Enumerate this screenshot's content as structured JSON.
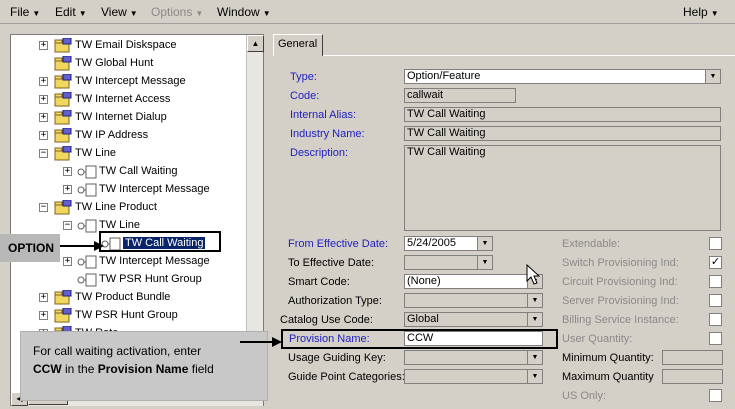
{
  "menubar": {
    "file": "File",
    "edit": "Edit",
    "view": "View",
    "options": "Options",
    "window": "Window",
    "help": "Help"
  },
  "tree": {
    "items": [
      {
        "label": "TW Email Diskspace",
        "expander": "+"
      },
      {
        "label": "TW Global Hunt",
        "expander": ""
      },
      {
        "label": "TW Intercept Message",
        "expander": "+"
      },
      {
        "label": "TW Internet Access",
        "expander": "+"
      },
      {
        "label": "TW Internet Dialup",
        "expander": "+"
      },
      {
        "label": "TW IP Address",
        "expander": "+"
      },
      {
        "label": "TW Line",
        "expander": "−"
      },
      {
        "label": "TW Call Waiting",
        "expander": "+"
      },
      {
        "label": "TW Intercept Message",
        "expander": "+"
      },
      {
        "label": "TW Line Product",
        "expander": "−"
      },
      {
        "label": "TW Line",
        "expander": "−"
      },
      {
        "label": "TW Call Waiting",
        "expander": ""
      },
      {
        "label": "TW Intercept Message",
        "expander": "+"
      },
      {
        "label": "TW PSR Hunt Group",
        "expander": ""
      },
      {
        "label": "TW Product Bundle",
        "expander": "+"
      },
      {
        "label": "TW PSR Hunt Group",
        "expander": "+"
      },
      {
        "label": "TW Rate",
        "expander": "+"
      }
    ]
  },
  "tabs": {
    "general": "General"
  },
  "form": {
    "type_label": "Type:",
    "type_value": "Option/Feature",
    "code_label": "Code:",
    "code_value": "callwait",
    "alias_label": "Internal Alias:",
    "alias_value": "TW Call Waiting",
    "industry_label": "Industry Name:",
    "industry_value": "TW Call Waiting",
    "desc_label": "Description:",
    "desc_value": "TW Call Waiting",
    "from_date_label": "From Effective Date:",
    "from_date_value": "5/24/2005",
    "to_date_label": "To Effective Date:",
    "to_date_value": "",
    "smart_code_label": "Smart Code:",
    "smart_code_value": "(None)",
    "auth_type_label": "Authorization Type:",
    "auth_type_value": "",
    "catalog_label": "Catalog Use Code:",
    "catalog_value": "Global",
    "provision_label": "Provision Name:",
    "provision_value": "CCW",
    "usage_label": "Usage Guiding Key:",
    "usage_value": "",
    "guide_label": "Guide Point Categories:",
    "guide_value": ""
  },
  "flags": {
    "extendable": "Extendable:",
    "switch_prov": "Switch Provisioning Ind:",
    "circuit_prov": "Circuit Provisioning Ind:",
    "server_prov": "Server Provisioning Ind:",
    "billing": "Billing Service Instance:",
    "user_qty": "User Quantity:",
    "min_qty": "Minimum Quantity:",
    "max_qty": "Maximum Quantity",
    "us_only": "US Only:",
    "switch_prov_checked": "✓"
  },
  "callouts": {
    "option_tag": "OPTION",
    "note_line1": "For call waiting activation, enter",
    "note_bold1": "CCW",
    "note_mid": " in the ",
    "note_bold2": "Provision Name",
    "note_end": " field"
  }
}
